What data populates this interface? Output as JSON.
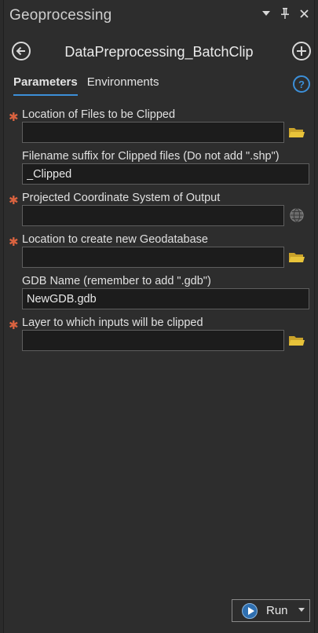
{
  "pane": {
    "title": "Geoprocessing",
    "controls": [
      "menu-dropdown-icon",
      "pin-icon",
      "close-icon"
    ]
  },
  "tool": {
    "name": "DataPreprocessing_BatchClip"
  },
  "tabs": [
    {
      "label": "Parameters",
      "active": true
    },
    {
      "label": "Environments",
      "active": false
    }
  ],
  "help_icon_glyph": "?",
  "parameters": [
    {
      "label": "Location of Files to be Clipped",
      "required": true,
      "value": "",
      "icon": "folder-icon"
    },
    {
      "label": "Filename suffix for Clipped files (Do not add \".shp\")",
      "required": false,
      "value": "_Clipped",
      "icon": ""
    },
    {
      "label": "Projected Coordinate System of Output",
      "required": true,
      "value": "",
      "icon": "globe-icon"
    },
    {
      "label": "Location to create new Geodatabase",
      "required": true,
      "value": "",
      "icon": "folder-icon"
    },
    {
      "label": "GDB Name (remember to add \".gdb\")",
      "required": false,
      "value": "NewGDB.gdb",
      "icon": ""
    },
    {
      "label": "Layer to which inputs will be clipped",
      "required": true,
      "value": "",
      "icon": "folder-icon"
    }
  ],
  "run": {
    "label": "Run"
  },
  "colors": {
    "accent": "#3c8fd8",
    "required_marker": "#d9623f",
    "folder": "#e8c33a",
    "background": "#2d2d2d"
  }
}
